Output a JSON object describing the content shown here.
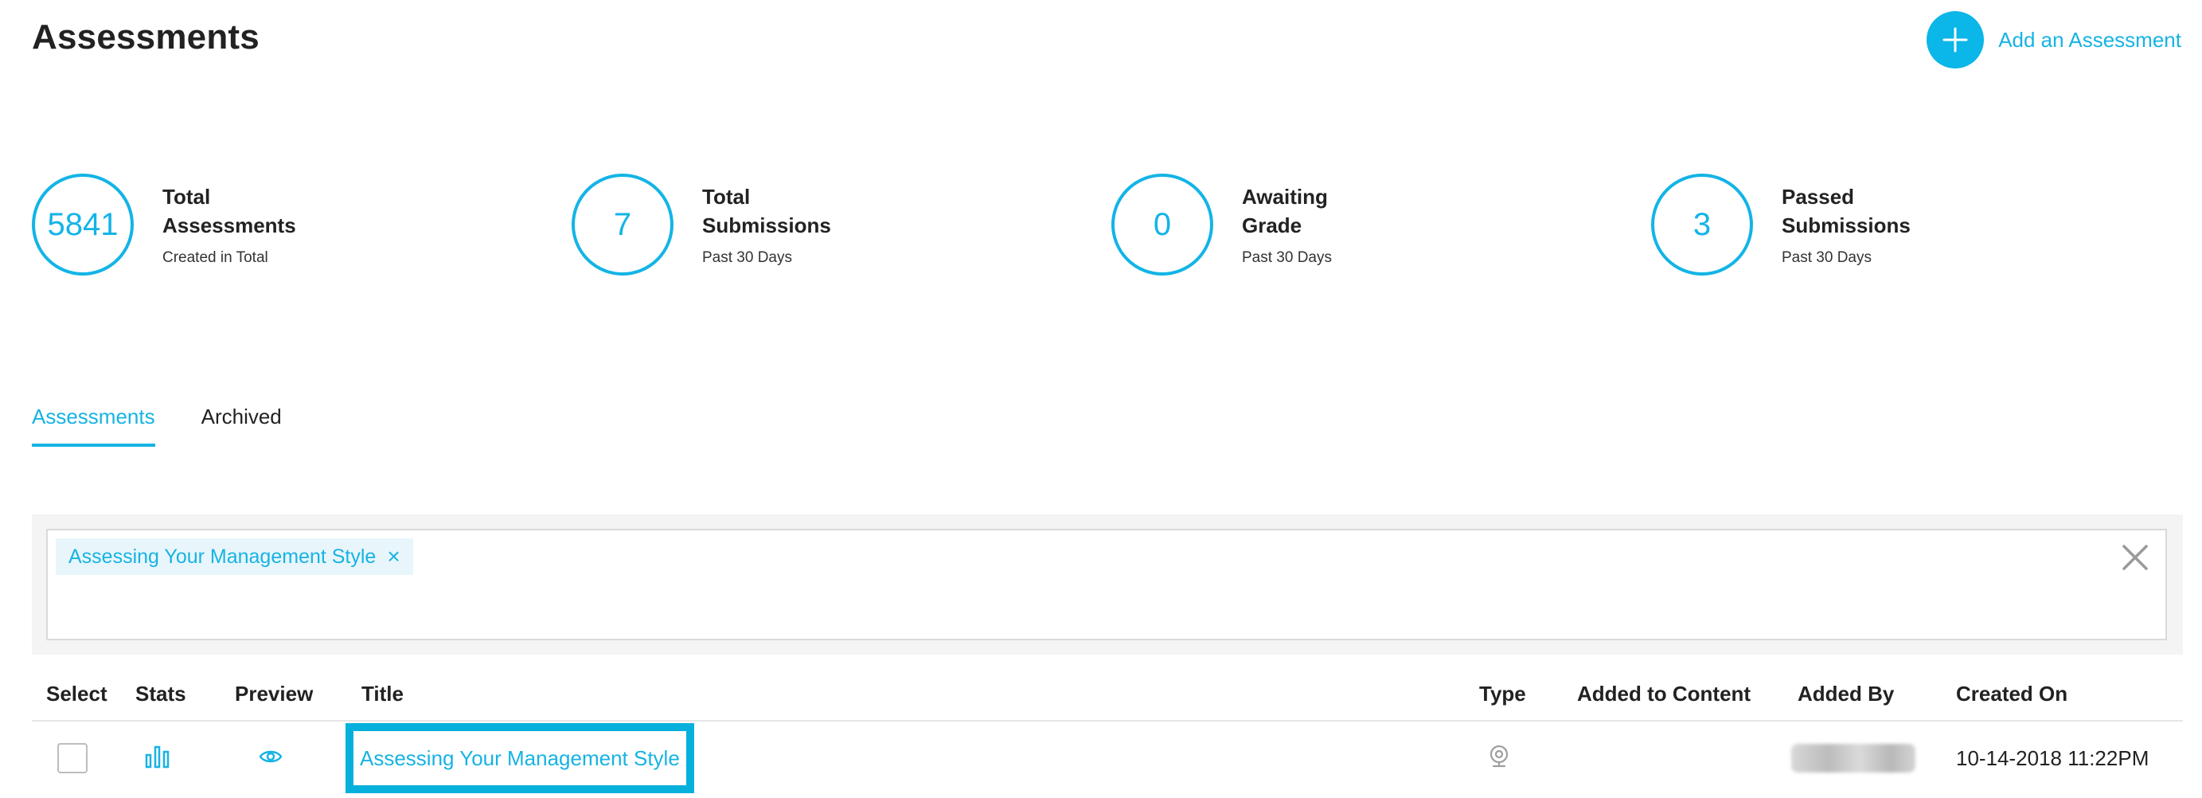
{
  "header": {
    "title": "Assessments",
    "add_label": "Add an Assessment"
  },
  "stats": [
    {
      "value": "5841",
      "title": "Total\nAssessments",
      "sub": "Created in Total"
    },
    {
      "value": "7",
      "title": "Total\nSubmissions",
      "sub": "Past 30 Days"
    },
    {
      "value": "0",
      "title": "Awaiting\nGrade",
      "sub": "Past 30 Days"
    },
    {
      "value": "3",
      "title": "Passed\nSubmissions",
      "sub": "Past 30 Days"
    }
  ],
  "tabs": [
    {
      "label": "Assessments",
      "active": true
    },
    {
      "label": "Archived",
      "active": false
    }
  ],
  "filter": {
    "chips": [
      {
        "label": "Assessing Your Management Style"
      }
    ]
  },
  "table": {
    "headers": [
      "Select",
      "Stats",
      "Preview",
      "Title",
      "Type",
      "Added to Content",
      "Added By",
      "Created On"
    ],
    "rows": [
      {
        "title": "Assessing Your Management Style",
        "type_icon": "webcam-icon",
        "added_to_content": "",
        "added_by": "",
        "created_on": "10-14-2018 11:22PM"
      }
    ]
  },
  "colors": {
    "accent": "#17b3e3",
    "highlight_border": "#05b0dc"
  }
}
